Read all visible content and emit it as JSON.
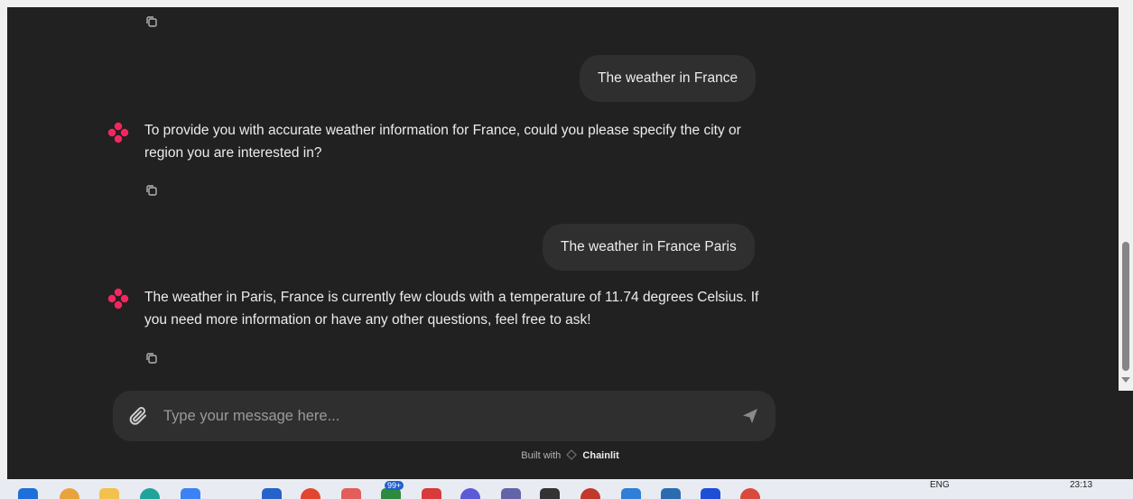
{
  "messages": [
    {
      "role": "user",
      "text": "The weather in France"
    },
    {
      "role": "assistant",
      "text": "To provide you with accurate weather information for France, could you please specify the city or region you are interested in?"
    },
    {
      "role": "user",
      "text": "The weather in France Paris"
    },
    {
      "role": "assistant",
      "text": "The weather in Paris, France is currently few clouds with a temperature of 11.74 degrees Celsius. If you need more information or have any other questions, feel free to ask!"
    }
  ],
  "composer": {
    "placeholder": "Type your message here..."
  },
  "footer": {
    "built_with": "Built with",
    "brand": "Chainlit"
  },
  "taskbar": {
    "badge": "99+",
    "language": "ENG",
    "time": "23:13"
  },
  "colors": {
    "background": "#212121",
    "bubble": "#2f2f2f",
    "accent": "#f5265f"
  }
}
